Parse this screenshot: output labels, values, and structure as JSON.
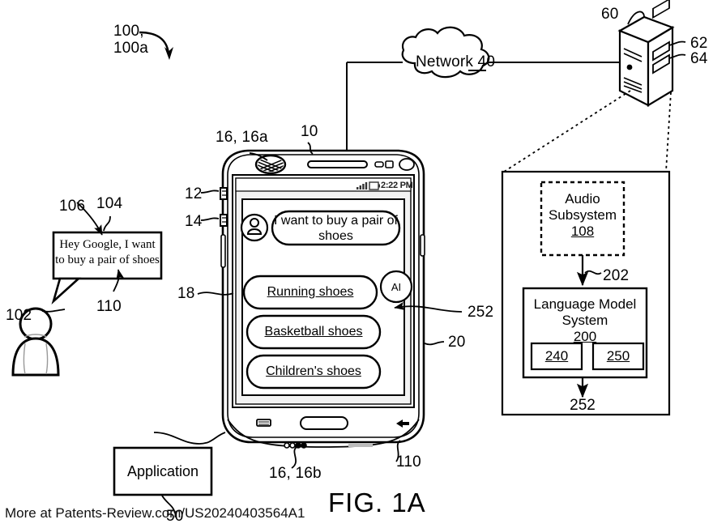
{
  "figure": {
    "title": "FIG. 1A",
    "watermark": "More at Patents-Review.com/US20240403564A1"
  },
  "callouts": {
    "system": "100,\n100a",
    "user": "102",
    "utterance_pointer": "106",
    "speech_bubble": "104",
    "audio_stream_left": "110",
    "audio_stream_right": "110",
    "device": "10",
    "mic_top": "16, 16a",
    "mic_bottom": "16, 16b",
    "button_12": "12",
    "button_14": "14",
    "display": "18",
    "gui": "20",
    "response_252": "252",
    "network": "Network 40",
    "network_num": "40",
    "server": "60",
    "server_62": "62",
    "server_64": "64",
    "application": "Application",
    "application_num": "50"
  },
  "phone": {
    "status_time": "2:22 PM",
    "user_message": "I want to buy a pair of\nshoes",
    "ai_badge": "AI",
    "options": [
      {
        "label": "Running shoes"
      },
      {
        "label": "Basketball shoes"
      },
      {
        "label": "Children's shoes"
      }
    ]
  },
  "speech_bubble": {
    "text": "Hey Google, I want to\nbuy a pair of shoes"
  },
  "server_detail": {
    "audio_subsystem": {
      "line1": "Audio",
      "line2": "Subsystem",
      "num": "108"
    },
    "arrow_label": "202",
    "language_model": {
      "line1": "Language Model",
      "line2": "System",
      "num": "200",
      "sub_left": "240",
      "sub_right": "250"
    },
    "output_label": "252"
  }
}
